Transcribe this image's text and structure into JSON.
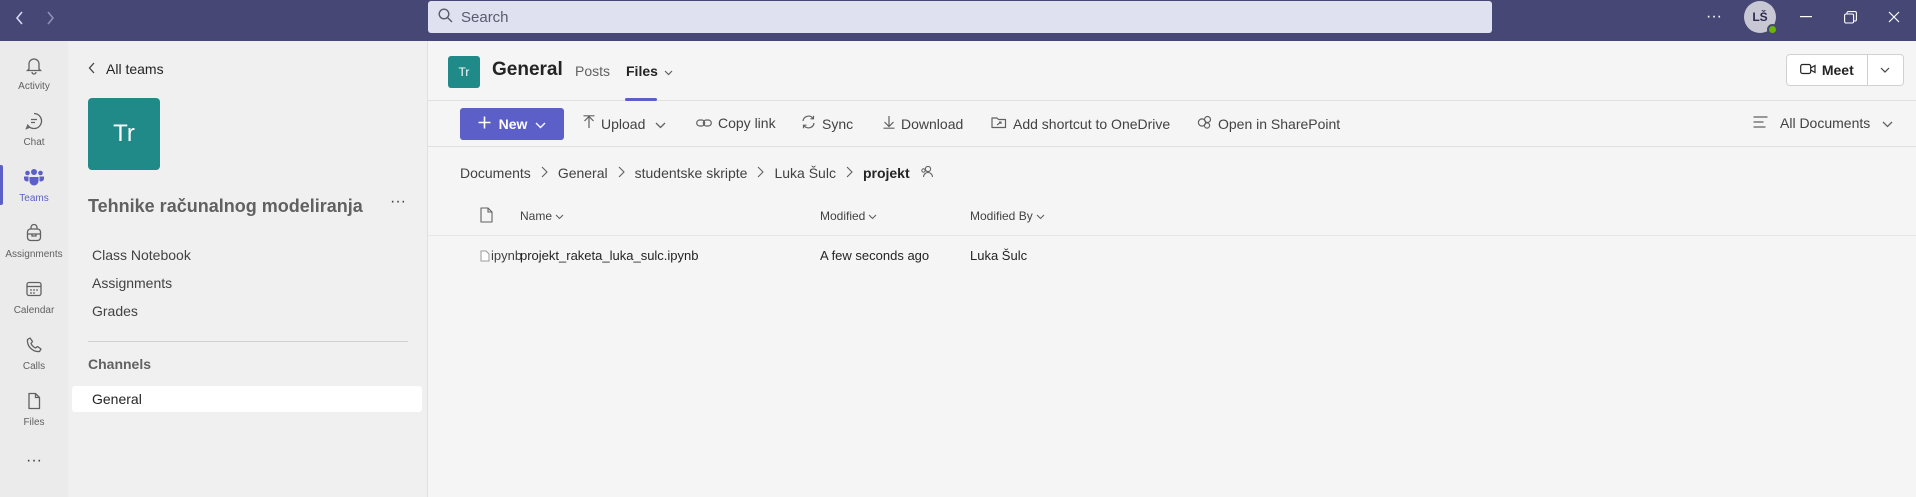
{
  "search": {
    "placeholder": "Search"
  },
  "user": {
    "initials": "LŠ"
  },
  "rail": [
    {
      "label": "Activity"
    },
    {
      "label": "Chat"
    },
    {
      "label": "Teams"
    },
    {
      "label": "Assignments"
    },
    {
      "label": "Calendar"
    },
    {
      "label": "Calls"
    },
    {
      "label": "Files"
    }
  ],
  "team": {
    "back_label": "All teams",
    "tile": "Tr",
    "name": "Tehnike računalnog modeliranja",
    "links": [
      "Class Notebook",
      "Assignments",
      "Grades"
    ],
    "channels_heading": "Channels",
    "selected_channel": "General"
  },
  "channel": {
    "icon": "Tr",
    "title": "General",
    "tabs": [
      "Posts",
      "Files"
    ],
    "meet_label": "Meet"
  },
  "toolbar": {
    "new": "New",
    "upload": "Upload",
    "copy_link": "Copy link",
    "sync": "Sync",
    "download": "Download",
    "shortcut": "Add shortcut to OneDrive",
    "sharepoint": "Open in SharePoint",
    "view": "All Documents"
  },
  "breadcrumb": [
    "Documents",
    "General",
    "studentske skripte",
    "Luka Šulc",
    "projekt"
  ],
  "columns": {
    "name": "Name",
    "modified": "Modified",
    "modified_by": "Modified By"
  },
  "files": [
    {
      "icon_alt": "ipynb",
      "name": "projekt_raketa_luka_sulc.ipynb",
      "modified": "A few seconds ago",
      "modified_by": "Luka Šulc"
    }
  ],
  "colors": {
    "titlebar": "#464775",
    "accent": "#5b5fc7",
    "team_tile": "#1f8a88"
  }
}
